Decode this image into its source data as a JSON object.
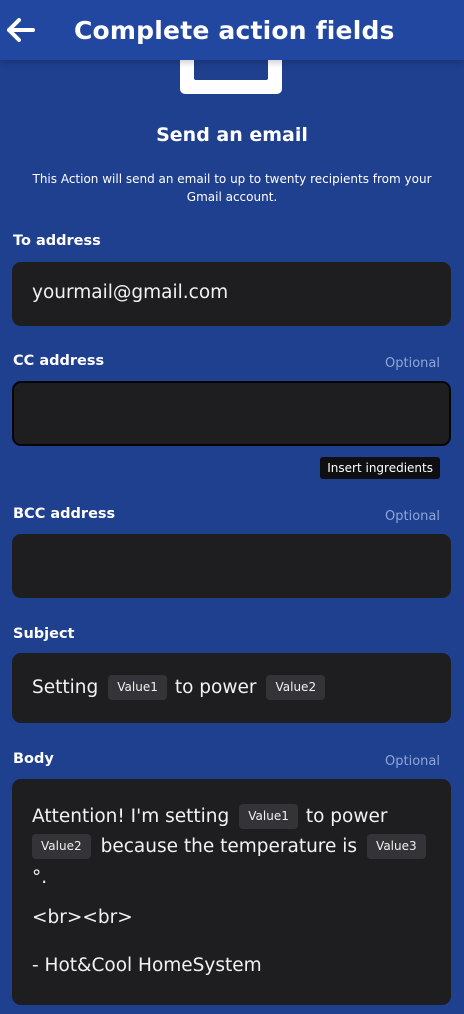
{
  "header": {
    "title": "Complete action fields"
  },
  "action": {
    "title": "Send an email",
    "description": "This Action will send an email to up to twenty recipients from your Gmail account."
  },
  "fields": {
    "to": {
      "label": "To address",
      "value": "yourmail@gmail.com"
    },
    "cc": {
      "label": "CC address",
      "optional": "Optional",
      "value": "",
      "helper_button": "Insert ingredients"
    },
    "bcc": {
      "label": "BCC address",
      "optional": "Optional",
      "value": ""
    },
    "subject": {
      "label": "Subject",
      "text1": "Setting",
      "ingredient1": "Value1",
      "text2": "to power",
      "ingredient2": "Value2"
    },
    "body": {
      "label": "Body",
      "optional": "Optional",
      "l1_text": "Attention! I'm setting",
      "l1_ing": "Value1",
      "l1_text2": "to power",
      "l2_ing": "Value2",
      "l2_text": "because the temperature is",
      "l2_ing2": "Value3",
      "l3_text": "°.",
      "l4_text": "<br><br>",
      "l5_text": "- Hot&Cool HomeSystem"
    }
  },
  "colors": {
    "background": "#1f3f8f",
    "field": "#1e1e20",
    "optional": "#8ea6d8"
  }
}
